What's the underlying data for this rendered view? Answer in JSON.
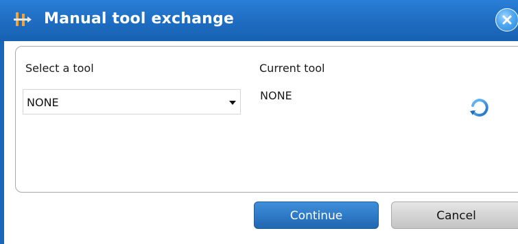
{
  "window": {
    "title": "Manual tool exchange",
    "title_icon": "tool-exchange-icon",
    "close_icon": "close-icon",
    "accent": "#1f6fc4"
  },
  "panel": {
    "select_label": "Select a tool",
    "select_value": "NONE",
    "current_label": "Current tool",
    "current_value": "NONE",
    "refresh_icon": "refresh-icon"
  },
  "buttons": {
    "continue": "Continue",
    "cancel": "Cancel"
  }
}
